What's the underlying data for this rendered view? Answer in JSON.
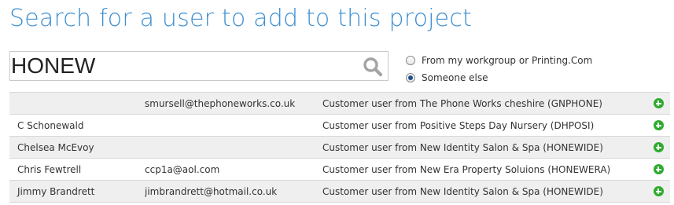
{
  "page": {
    "title": "Search for a user to add to this project"
  },
  "search": {
    "value": "HONEW",
    "icon": "search-icon"
  },
  "scope": {
    "options": [
      {
        "label": "From my workgroup or Printing.Com",
        "checked": false
      },
      {
        "label": "Someone else",
        "checked": true
      }
    ]
  },
  "results": [
    {
      "name": "",
      "email": "smursell@thephoneworks.co.uk",
      "description": "Customer user from The Phone Works cheshire (GNPHONE)"
    },
    {
      "name": "C Schonewald",
      "email": "",
      "description": "Customer user from Positive Steps Day Nursery (DHPOSI)"
    },
    {
      "name": "Chelsea McEvoy",
      "email": "",
      "description": "Customer user from New Identity Salon & Spa (HONEWIDE)"
    },
    {
      "name": "Chris Fewtrell",
      "email": "ccp1a@aol.com",
      "description": "Customer user from New Era Property Soluions (HONEWERA)"
    },
    {
      "name": "Jimmy Brandrett",
      "email": "jimbrandrett@hotmail.co.uk",
      "description": "Customer user from New Identity Salon & Spa (HONEWIDE)"
    }
  ],
  "colors": {
    "title": "#3d8fd1",
    "add": "#2eab2e",
    "row_alt": "#efefef"
  }
}
